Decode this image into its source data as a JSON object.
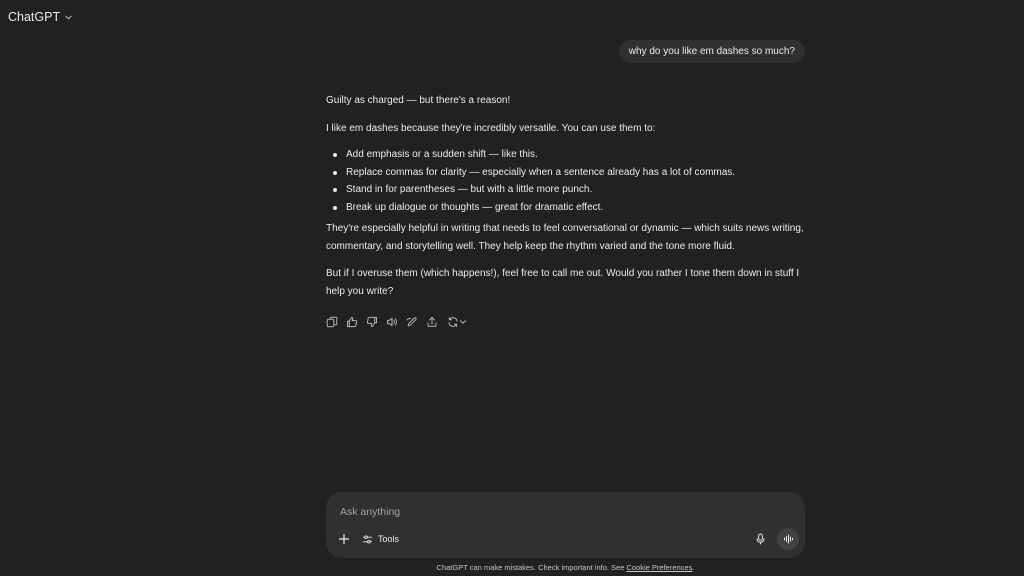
{
  "header": {
    "model_label": "ChatGPT",
    "model_icon": "chevron-down-icon"
  },
  "conversation": {
    "user_message": "why do you like em dashes so much?",
    "assistant": {
      "intro": "Guilty as charged — but there's a reason!",
      "lead": "I like em dashes because they're incredibly versatile. You can use them to:",
      "bullets": [
        "Add emphasis or a sudden shift — like this.",
        "Replace commas for clarity — especially when a sentence already has a lot of commas.",
        "Stand in for parentheses — but with a little more punch.",
        "Break up dialogue or thoughts — great for dramatic effect."
      ],
      "body": "They're especially helpful in writing that needs to feel conversational or dynamic — which suits news writing, commentary, and storytelling well. They help keep the rhythm varied and the tone more fluid.",
      "closing": "But if I overuse them (which happens!), feel free to call me out. Would you rather I tone them down in stuff I help you write?"
    },
    "actions": [
      "copy-icon",
      "thumbs-up-icon",
      "thumbs-down-icon",
      "read-aloud-icon",
      "edit-canvas-icon",
      "share-icon",
      "regenerate-icon"
    ]
  },
  "composer": {
    "placeholder": "Ask anything",
    "value": "",
    "tools_label": "Tools",
    "icons": [
      "plus-icon",
      "tools-icon",
      "microphone-icon",
      "voice-mode-icon"
    ]
  },
  "footer": {
    "disclaimer_prefix": "ChatGPT can make mistakes. Check important info. See ",
    "disclaimer_link": "Cookie Preferences",
    "disclaimer_suffix": "."
  },
  "colors": {
    "background": "#212121",
    "surface": "#303030",
    "text": "#ececec",
    "muted": "#b4b4b4"
  }
}
